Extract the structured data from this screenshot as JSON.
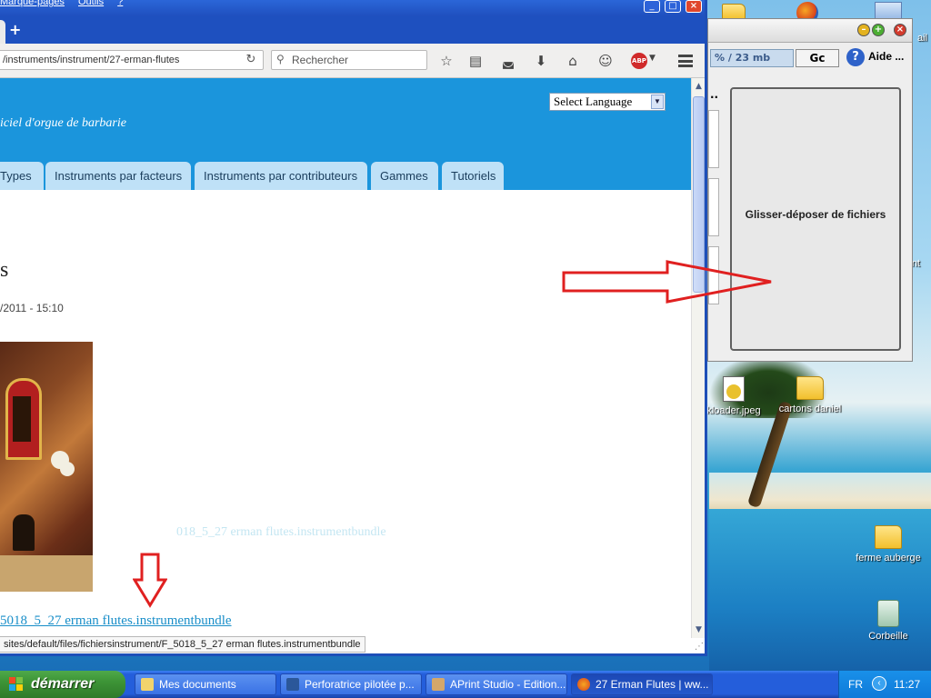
{
  "browser": {
    "menu": [
      "Marque-pages",
      "Outils",
      "?"
    ],
    "new_tab_glyph": "+",
    "url": "/instruments/instrument/27-erman-flutes",
    "search_placeholder": "Rechercher",
    "icons": [
      "star-icon",
      "reading-list-icon",
      "pocket-icon",
      "download-icon",
      "home-icon",
      "chat-icon",
      "adblock-icon",
      "menu-icon"
    ],
    "abp_label": "ABP",
    "status_url": "sites/default/files/fichiersinstrument/F_5018_5_27 erman flutes.instrumentbundle"
  },
  "page": {
    "slogan": "iciel d'orgue de barbarie",
    "language_select": "Select Language",
    "nav": [
      "Types",
      "Instruments par facteurs",
      "Instruments par contributeurs",
      "Gammes",
      "Tutoriels"
    ],
    "title": "s",
    "date": "/2011 - 15:10",
    "ghost_link": "018_5_27 erman flutes.instrumentbundle",
    "file_link": "5018_5_27 erman flutes.instrumentbundle"
  },
  "java_app": {
    "memory": "% / 23 mb",
    "gc_label": "Gc",
    "help_label": "Aide ...",
    "dots": "..",
    "drop_label": "Glisser-déposer de fichiers"
  },
  "desktop": {
    "icons": [
      {
        "label": "kloader.jpeg"
      },
      {
        "label": "cartons daniel"
      },
      {
        "label": "ferme auberge"
      },
      {
        "label": "Corbeille"
      }
    ],
    "edge_labels": [
      "ail",
      "nt"
    ]
  },
  "taskbar": {
    "start": "démarrer",
    "tasks": [
      "Mes documents",
      "Perforatrice pilotée p...",
      "APrint Studio - Edition...",
      "27 Erman Flutes | ww..."
    ],
    "lang": "FR",
    "clock": "11:27"
  },
  "colors": {
    "header_blue": "#1b95dc",
    "nav_tab": "#bfe1f7",
    "link": "#1a8fc9",
    "arrow_red": "#e02020",
    "xp_blue": "#245edb",
    "start_green": "#3d9436"
  }
}
